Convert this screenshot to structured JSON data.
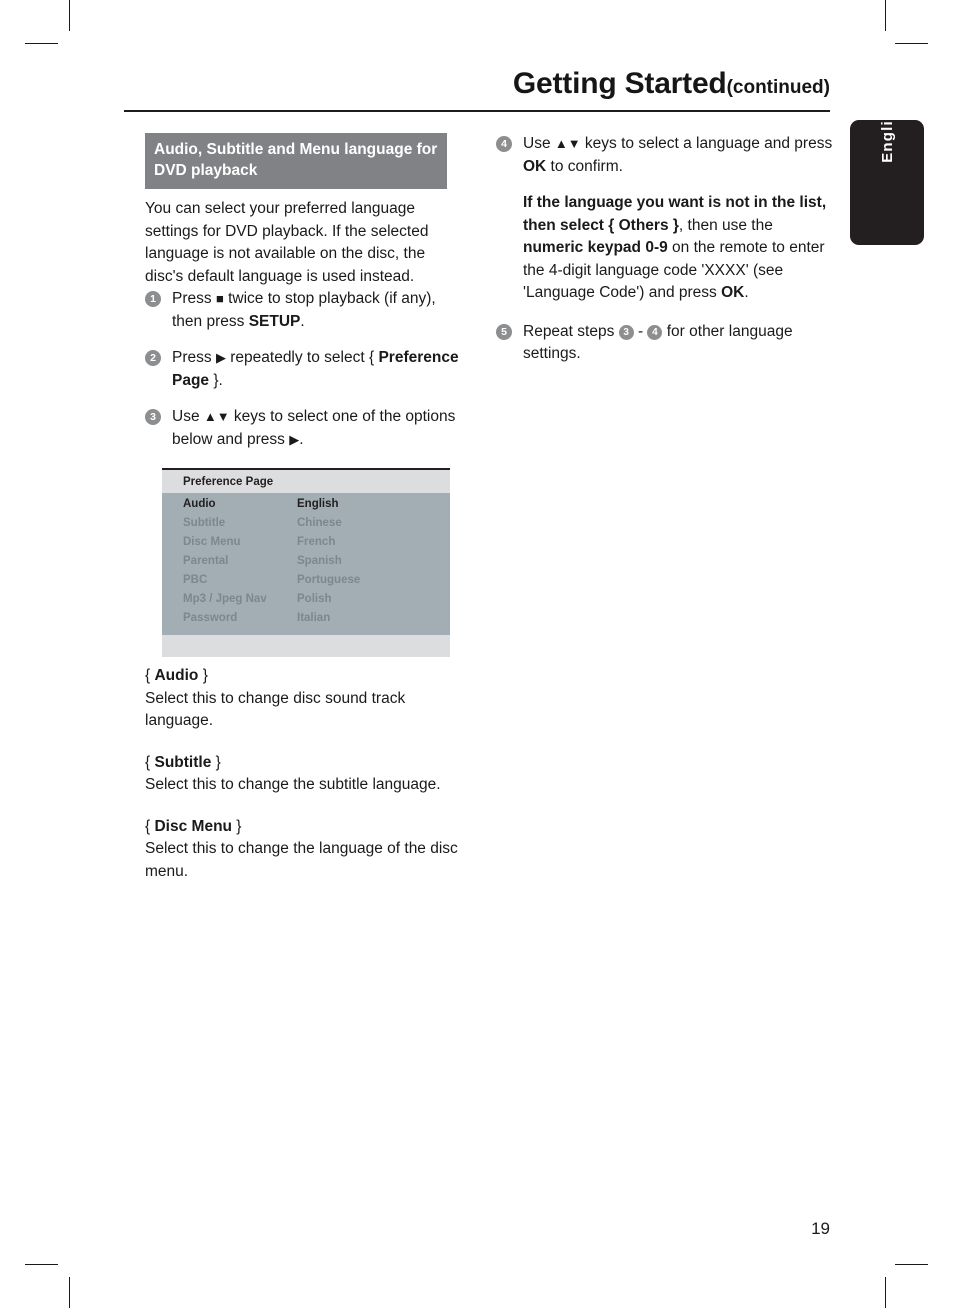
{
  "header": {
    "title_main": "Getting Started",
    "title_suffix": "(continued)"
  },
  "language_tab": {
    "label": "English"
  },
  "left_column": {
    "section_heading": "Audio, Subtitle and Menu language for DVD playback",
    "intro": "You can select your preferred language settings for DVD playback. If the selected language is not available on the disc, the disc's default language is used instead.",
    "steps": [
      {
        "number": "1",
        "parts": [
          {
            "type": "text",
            "value": "Press "
          },
          {
            "type": "icon",
            "value": "■",
            "name": "stop-icon"
          },
          {
            "type": "text",
            "value": " twice to stop playback (if any), then press "
          },
          {
            "type": "bold",
            "value": "SETUP"
          },
          {
            "type": "text",
            "value": "."
          }
        ]
      },
      {
        "number": "2",
        "parts": [
          {
            "type": "text",
            "value": "Press "
          },
          {
            "type": "icon",
            "value": "▶",
            "name": "right-arrow-icon"
          },
          {
            "type": "text",
            "value": " repeatedly to select { "
          },
          {
            "type": "bold",
            "value": "Preference Page"
          },
          {
            "type": "text",
            "value": " }."
          }
        ]
      },
      {
        "number": "3",
        "parts": [
          {
            "type": "text",
            "value": "Use "
          },
          {
            "type": "icon",
            "value": "▲▼",
            "name": "up-down-arrow-icon"
          },
          {
            "type": "text",
            "value": " keys to select one of the options below and press "
          },
          {
            "type": "icon",
            "value": "▶",
            "name": "right-arrow-icon"
          },
          {
            "type": "text",
            "value": "."
          }
        ]
      }
    ]
  },
  "preference_screenshot": {
    "title": "Preference Page",
    "rows": [
      {
        "label": "Audio",
        "value": "English",
        "selected": true
      },
      {
        "label": "Subtitle",
        "value": "Chinese",
        "selected": false
      },
      {
        "label": "Disc Menu",
        "value": "French",
        "selected": false
      },
      {
        "label": "Parental",
        "value": "Spanish",
        "selected": false
      },
      {
        "label": "PBC",
        "value": "Portuguese",
        "selected": false
      },
      {
        "label": "Mp3 / Jpeg Nav",
        "value": "Polish",
        "selected": false
      },
      {
        "label": "Password",
        "value": "Italian",
        "selected": false
      }
    ],
    "colors": {
      "header_bg": "#dcdddf",
      "body_bg": "#a2aeb4",
      "selected_text": "#231f20",
      "dim_text": "#7d878d"
    }
  },
  "definitions": [
    {
      "term_open": "{ ",
      "term_name": "Audio",
      "term_close": " }",
      "text": "Select this to change disc sound track language."
    },
    {
      "term_open": "{ ",
      "term_name": "Subtitle",
      "term_close": " }",
      "text": "Select this to change the subtitle language."
    },
    {
      "term_open": "{ ",
      "term_name": "Disc Menu",
      "term_close": " }",
      "text": "Select this to change the language of the disc menu."
    }
  ],
  "right_column": {
    "step4": {
      "number": "4",
      "parts": [
        {
          "type": "text",
          "value": "Use "
        },
        {
          "type": "icon",
          "value": "▲▼",
          "name": "up-down-arrow-icon"
        },
        {
          "type": "text",
          "value": " keys to select a language and press "
        },
        {
          "type": "bold",
          "value": "OK"
        },
        {
          "type": "text",
          "value": " to confirm."
        }
      ]
    },
    "note": [
      {
        "type": "bold",
        "value": "If the language you want is not in the list, then select { Others }"
      },
      {
        "type": "text",
        "value": ", then use the "
      },
      {
        "type": "bold",
        "value": "numeric keypad 0-9"
      },
      {
        "type": "text",
        "value": " on the remote to enter the 4-digit language code 'XXXX' (see 'Language Code') and press "
      },
      {
        "type": "bold",
        "value": "OK"
      },
      {
        "type": "text",
        "value": "."
      }
    ],
    "step5": {
      "number": "5",
      "parts": [
        {
          "type": "text",
          "value": "Repeat steps "
        },
        {
          "type": "circle",
          "value": "3"
        },
        {
          "type": "text",
          "value": " - "
        },
        {
          "type": "circle",
          "value": "4"
        },
        {
          "type": "text",
          "value": " for other language settings."
        }
      ]
    }
  },
  "footer": {
    "page_number": "19"
  },
  "colors": {
    "section_heading_bg": "#808285",
    "step_bullet_bg": "#8c8e90",
    "tab_bg": "#231f20",
    "rule": "#1c1c1c"
  }
}
